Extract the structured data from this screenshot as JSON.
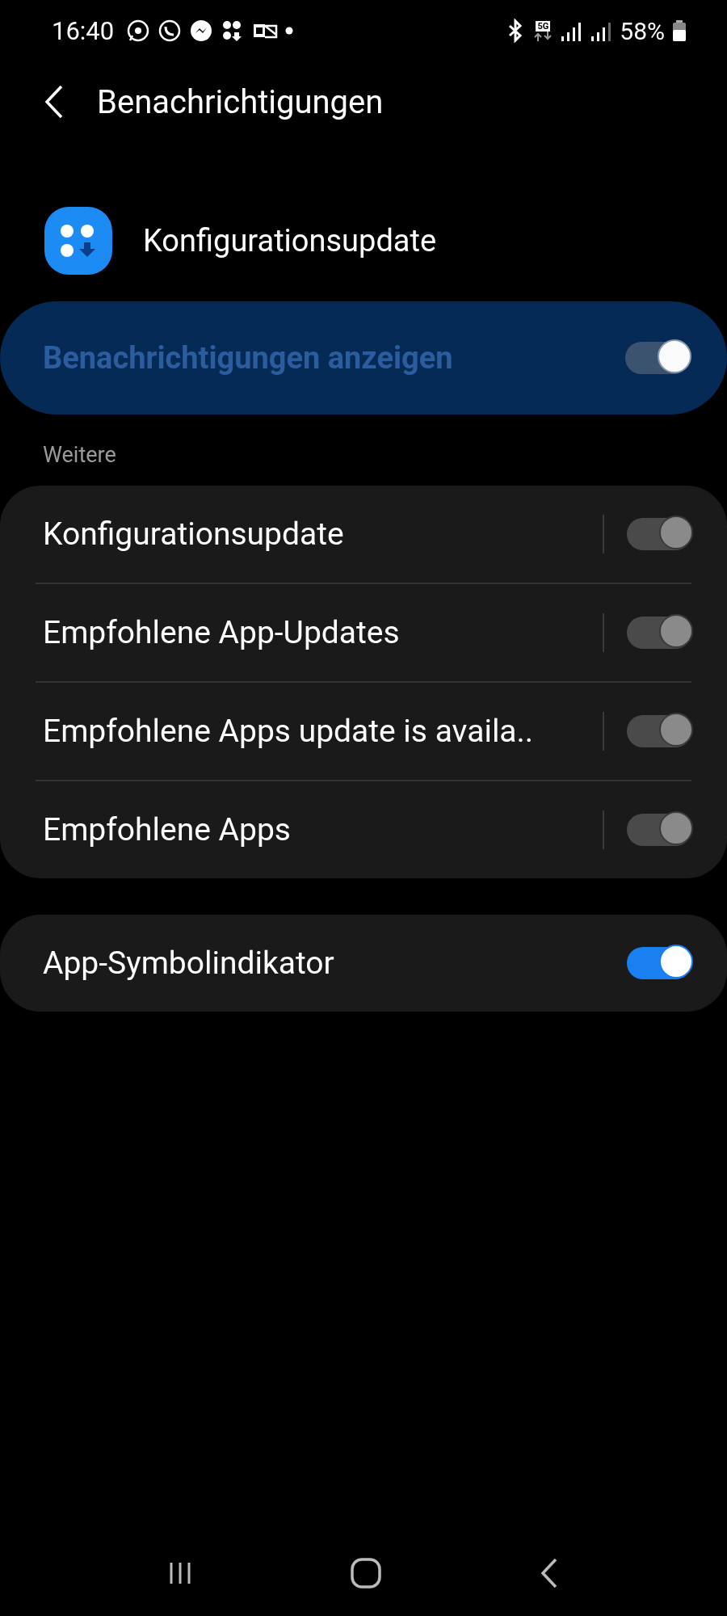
{
  "status_bar": {
    "time": "16:40",
    "battery": "58%",
    "network": "5G"
  },
  "header": {
    "title": "Benachrichtigungen"
  },
  "app": {
    "name": "Konfigurationsupdate"
  },
  "master": {
    "label": "Benachrichtigungen anzeigen",
    "on": true,
    "disabled": true
  },
  "section": {
    "title": "Weitere"
  },
  "channels": [
    {
      "label": "Konfigurationsupdate",
      "on": true,
      "disabled": true
    },
    {
      "label": "Empfohlene App-Updates",
      "on": true,
      "disabled": true
    },
    {
      "label": "Empfohlene Apps update is availa..",
      "on": true,
      "disabled": true
    },
    {
      "label": "Empfohlene Apps",
      "on": true,
      "disabled": true
    }
  ],
  "badge_setting": {
    "label": "App-Symbolindikator",
    "on": true,
    "disabled": false
  }
}
